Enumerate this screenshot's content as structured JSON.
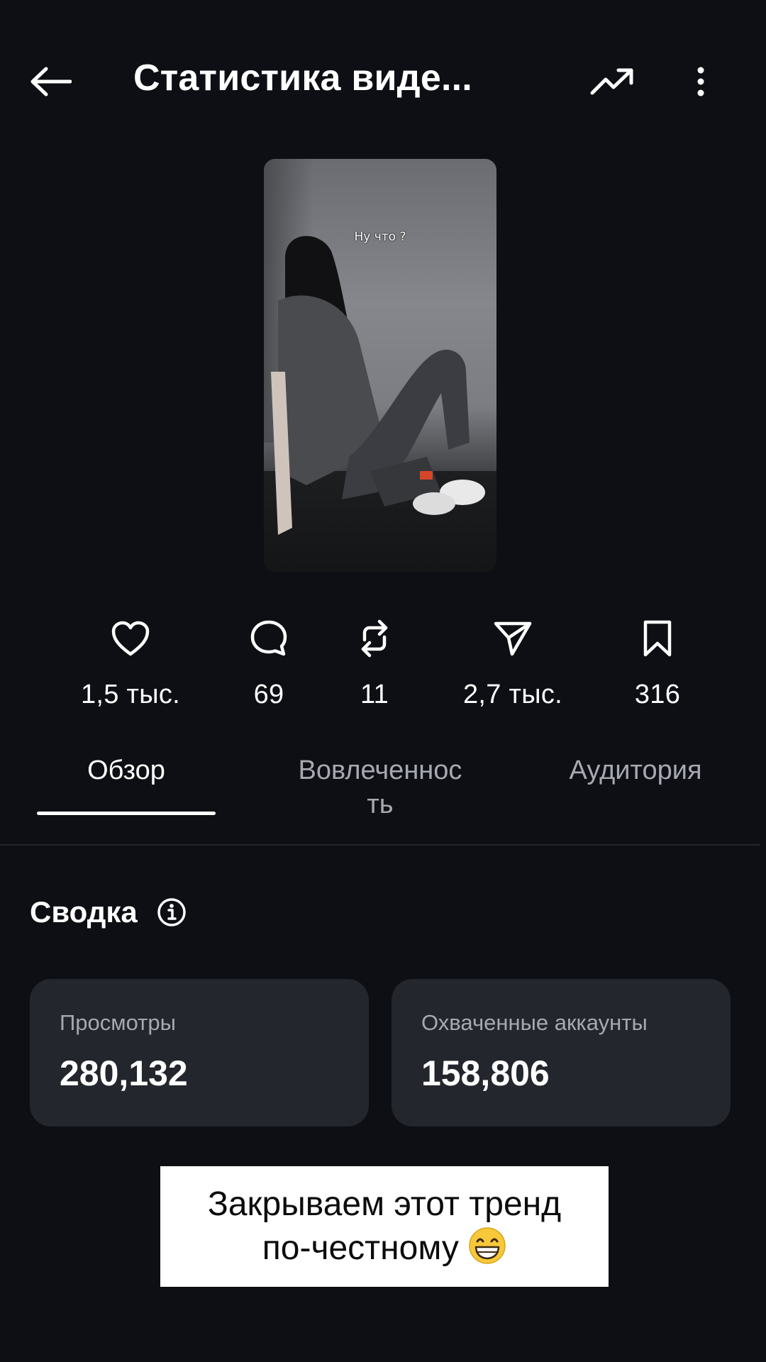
{
  "header": {
    "title": "Статистика виде...",
    "back_icon": "arrow-left-icon",
    "trend_icon": "trending-up-icon",
    "more_icon": "more-vertical-icon"
  },
  "video": {
    "overlay_text": "Ну что ?"
  },
  "stats": [
    {
      "icon": "heart-icon",
      "value": "1,5 тыс."
    },
    {
      "icon": "comment-icon",
      "value": "69"
    },
    {
      "icon": "repost-icon",
      "value": "11"
    },
    {
      "icon": "share-icon",
      "value": "2,7 тыс."
    },
    {
      "icon": "bookmark-icon",
      "value": "316"
    }
  ],
  "tabs": [
    {
      "label": "Обзор",
      "active": true
    },
    {
      "label_line1": "Вовлеченнос",
      "label_line2": "ть",
      "active": false
    },
    {
      "label": "Аудитория",
      "active": false
    }
  ],
  "summary": {
    "title": "Сводка",
    "info_icon": "info-icon",
    "cards": [
      {
        "label": "Просмотры",
        "value": "280,132"
      },
      {
        "label": "Охваченные аккаунты",
        "value": "158,806"
      }
    ]
  },
  "caption": {
    "line1": "Закрываем этот тренд",
    "line2": "по-честному",
    "emoji": "grinning-face-emoji"
  },
  "colors": {
    "background": "#0d0f14",
    "card": "#24262d",
    "muted_text": "#a6a9b1",
    "divider": "#22252b"
  }
}
